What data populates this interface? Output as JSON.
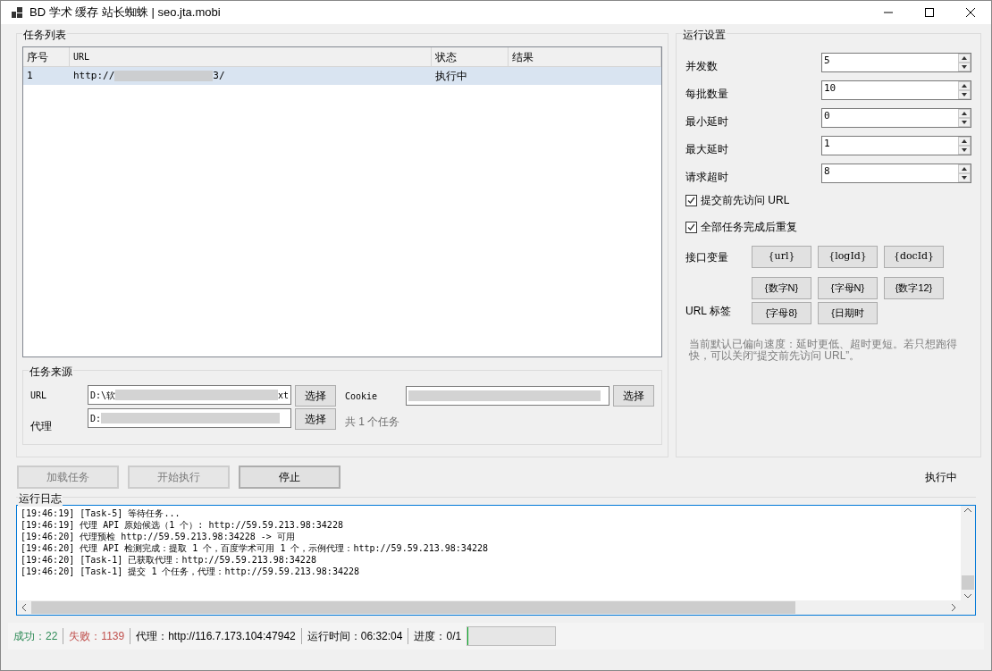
{
  "window": {
    "title": "BD 学术 缓存 站长蜘蛛 | seo.jta.mobi"
  },
  "task_list": {
    "title": "任务列表",
    "columns": [
      "序号",
      "URL",
      "状态",
      "结果"
    ],
    "rows": [
      {
        "index": "1",
        "url_start": "http://",
        "url_end": "3/",
        "status": "执行中",
        "result": "",
        "selected": true
      }
    ]
  },
  "task_source": {
    "title": "任务来源",
    "url_label": "URL",
    "url_value_start": "D:\\软",
    "url_value_end": "xt",
    "url_button": "选择",
    "proxy_label": "代理",
    "proxy_value_start": "D:",
    "proxy_button": "选择",
    "cookie_label": "Cookie",
    "cookie_button": "选择",
    "task_count": "共 1 个任务"
  },
  "actions": [
    {
      "label": "加载任务",
      "disabled": true
    },
    {
      "label": "开始执行",
      "disabled": true
    },
    {
      "label": "停止",
      "disabled": false
    }
  ],
  "run_state": "执行中",
  "settings": {
    "title": "运行设置",
    "spinners": [
      {
        "label": "并发数",
        "value": "5"
      },
      {
        "label": "每批数量",
        "value": "10"
      },
      {
        "label": "最小延时",
        "value": "0"
      },
      {
        "label": "最大延时",
        "value": "1"
      },
      {
        "label": "请求超时",
        "value": "8"
      }
    ],
    "checkboxes": [
      {
        "label": "提交前先访问 URL",
        "checked": true
      },
      {
        "label": "全部任务完成后重复",
        "checked": true
      }
    ],
    "api_vars_label": "接口变量",
    "api_vars": [
      "{url}",
      "{logId}",
      "{docId}"
    ],
    "url_tags_label": "URL 标签",
    "url_tags": [
      "{数字N}",
      "{字母N}",
      "{数字12}",
      "{字母8}",
      "{日期时"
    ],
    "note": "当前默认已偏向速度：延时更低、超时更短。若只想跑得快，可以关闭“提交前先访问 URL”。"
  },
  "log": {
    "title": "运行日志",
    "lines": [
      "[19:46:19] [Task-5] 等待任务...",
      "[19:46:19] 代理 API 原始候选（1 个）: http://59.59.213.98:34228",
      "[19:46:20] 代理预检 http://59.59.213.98:34228 -> 可用",
      "[19:46:20] 代理 API 检测完成：提取 1 个，百度学术可用 1 个，示例代理：http://59.59.213.98:34228",
      "[19:46:20] [Task-1] 已获取代理：http://59.59.213.98:34228",
      "[19:46:20] [Task-1] 提交 1 个任务，代理：http://59.59.213.98:34228"
    ]
  },
  "status_bar": {
    "success": "成功：22",
    "fail": "失败：1139",
    "proxy": "代理：http://116.7.173.104:47942",
    "runtime": "运行时间：06:32:04",
    "progress": "进度：0/1",
    "level": 0
  }
}
